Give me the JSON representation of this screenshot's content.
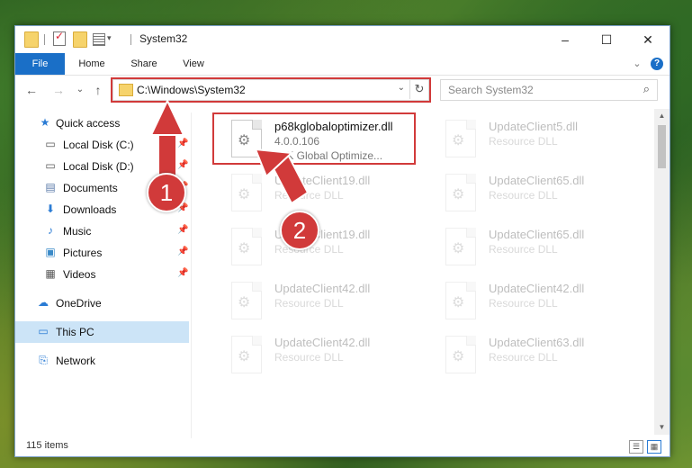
{
  "window": {
    "title": "System32",
    "controls": {
      "minimize": "–",
      "maximize": "☐",
      "close": "✕"
    }
  },
  "ribbon": {
    "tabs": [
      "File",
      "Home",
      "Share",
      "View"
    ],
    "expand": "⌄",
    "help": "?"
  },
  "nav": {
    "back": "←",
    "forward": "→",
    "recent": "⌄",
    "up": "↑",
    "address": "C:\\Windows\\System32",
    "address_dropdown": "⌄",
    "refresh": "↻",
    "search_placeholder": "Search System32",
    "search_icon": "⌕"
  },
  "sidebar": {
    "items": [
      {
        "label": "Quick access",
        "icon": "star-icon",
        "glyph": "★",
        "pinned": false
      },
      {
        "label": "Local Disk (C:)",
        "icon": "drive-icon",
        "glyph": "▭",
        "pinned": true
      },
      {
        "label": "Local Disk (D:)",
        "icon": "drive-icon",
        "glyph": "▭",
        "pinned": true
      },
      {
        "label": "Documents",
        "icon": "documents-icon",
        "glyph": "▤",
        "pinned": true
      },
      {
        "label": "Downloads",
        "icon": "downloads-icon",
        "glyph": "⬇",
        "pinned": true
      },
      {
        "label": "Music",
        "icon": "music-icon",
        "glyph": "♪",
        "pinned": true
      },
      {
        "label": "Pictures",
        "icon": "pictures-icon",
        "glyph": "▣",
        "pinned": true
      },
      {
        "label": "Videos",
        "icon": "videos-icon",
        "glyph": "▦",
        "pinned": true
      },
      {
        "label": "OneDrive",
        "icon": "cloud-icon",
        "glyph": "☁",
        "pinned": false
      },
      {
        "label": "This PC",
        "icon": "computer-icon",
        "glyph": "▭",
        "pinned": false
      },
      {
        "label": "Network",
        "icon": "network-icon",
        "glyph": "⎘",
        "pinned": false
      }
    ]
  },
  "files": [
    {
      "name": "p68kglobaloptimizer.dll",
      "line2": "4.0.0.106",
      "line3": "68K Global Optimize..."
    },
    {
      "name": "UpdateClient5.dll",
      "line2": "Resource DLL",
      "line3": ""
    },
    {
      "name": "UpdateClient19.dll",
      "line2": "Resource DLL",
      "line3": ""
    },
    {
      "name": "UpdateClient65.dll",
      "line2": "Resource DLL",
      "line3": ""
    },
    {
      "name": "UpdateClient19.dll",
      "line2": "Resource DLL",
      "line3": ""
    },
    {
      "name": "UpdateClient65.dll",
      "line2": "Resource DLL",
      "line3": ""
    },
    {
      "name": "UpdateClient42.dll",
      "line2": "Resource DLL",
      "line3": ""
    },
    {
      "name": "UpdateClient42.dll",
      "line2": "Resource DLL",
      "line3": ""
    },
    {
      "name": "UpdateClient42.dll",
      "line2": "Resource DLL",
      "line3": ""
    },
    {
      "name": "UpdateClient63.dll",
      "line2": "Resource DLL",
      "line3": ""
    }
  ],
  "status": {
    "items": "115 items"
  },
  "annotations": {
    "step1": "1",
    "step2": "2",
    "color": "#d13a3a"
  },
  "colors": {
    "accent": "#1a6fc7",
    "selection": "#cce4f7",
    "highlight": "#d13a3a"
  }
}
